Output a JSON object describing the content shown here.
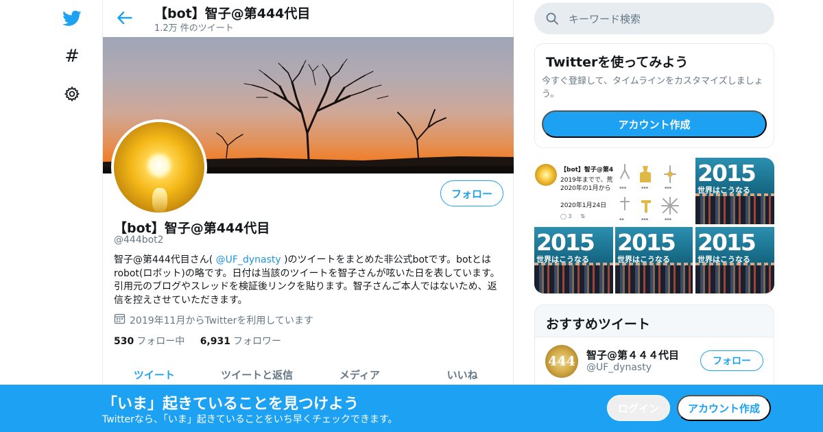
{
  "colors": {
    "accent": "#1da1f2",
    "text": "#14171a",
    "muted": "#657786",
    "border": "#e6ecf0"
  },
  "leftnav": {
    "icons": [
      "twitter-bird-icon",
      "hashtag-icon",
      "gear-icon"
    ],
    "explore_glyph": "#"
  },
  "header": {
    "name": "【bot】智子@第444代目",
    "tweet_count": "1.2万 件のツイート"
  },
  "profile": {
    "follow_label": "フォロー",
    "name": "【bot】智子@第444代目",
    "handle": "@444bot2",
    "bio_before": "智子@第444代目さん( ",
    "bio_mention": "@UF_dynasty",
    "bio_after": " )のツイートをまとめた非公式botです。botとはrobot(ロボット)の略です。日付は当該のツイートを智子さんが呟いた日を表しています。引用元のブログやスレッドを検証後リンクを貼ります。智子さんご本人ではないため、返信を控えさせていただきます。",
    "joined": "2019年11月からTwitterを利用しています",
    "following_count": "530",
    "following_label": "フォロー中",
    "followers_count": "6,931",
    "followers_label": "フォロワー"
  },
  "tabs": [
    {
      "label": "ツイート",
      "active": true
    },
    {
      "label": "ツイートと返信",
      "active": false
    },
    {
      "label": "メディア",
      "active": false
    },
    {
      "label": "いいね",
      "active": false
    }
  ],
  "search": {
    "placeholder": "キーワード検索"
  },
  "try_card": {
    "title": "Twitterを使ってみよう",
    "description": "今すぐ登録して、タイムラインをカスタマイズしましょう。",
    "button": "アカウント作成"
  },
  "media_grid": {
    "tweet_name": "【bot】智子@第4",
    "tweet_line1": "2019年までで、荒",
    "tweet_line2": "2020年の1月から",
    "tweet_date": "2020年1月24日",
    "tweet_reply_count": "3",
    "cover_year": "2015",
    "cover_subtitle": "世界はこうなる"
  },
  "recommended": {
    "title": "おすすめツイート",
    "avatar_text": "444",
    "name": "智子@第４４４代目",
    "handle": "@UF_dynasty",
    "follow_label": "フォロー"
  },
  "bottom_bar": {
    "title": "「いま」起きていることを見つけよう",
    "subtitle": "Twitterなら、「いま」起きていることをいち早くチェックできます。",
    "login": "ログイン",
    "signup": "アカウント作成"
  }
}
